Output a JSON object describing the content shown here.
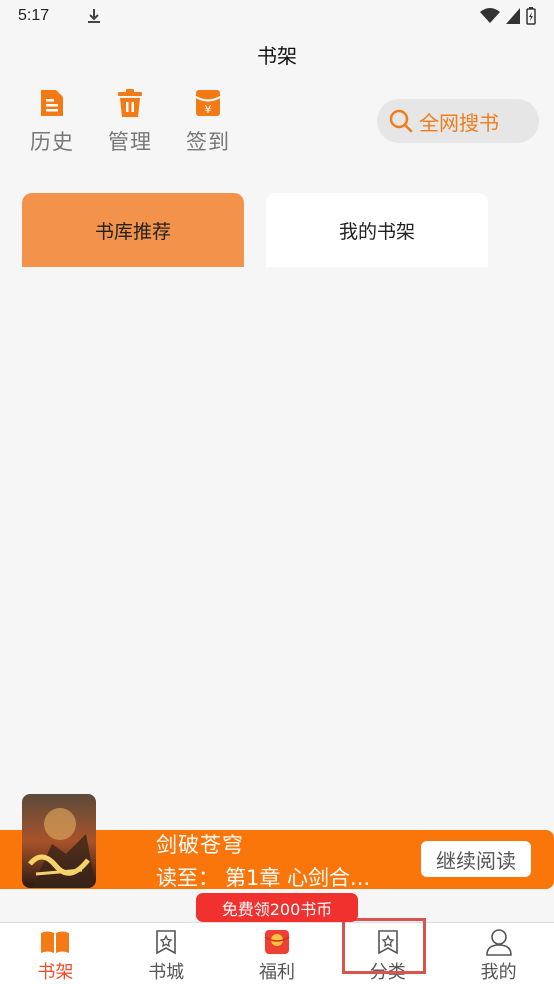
{
  "status_bar": {
    "time": "5:17"
  },
  "header": {
    "title": "书架"
  },
  "quick_actions": [
    {
      "label": "历史",
      "icon": "history-doc-icon"
    },
    {
      "label": "管理",
      "icon": "trash-icon"
    },
    {
      "label": "签到",
      "icon": "red-envelope-icon"
    }
  ],
  "search": {
    "label": "全网搜书",
    "icon": "search-icon"
  },
  "tabs": [
    {
      "label": "书库推荐",
      "active": true
    },
    {
      "label": "我的书架",
      "active": false
    }
  ],
  "continue_reading": {
    "book_title": "剑破苍穹",
    "progress_prefix": "读至：",
    "progress_chapter": "第1章 心剑合...",
    "button_label": "继续阅读"
  },
  "promo": {
    "label": "免费领200书币"
  },
  "bottom_nav": [
    {
      "label": "书架",
      "icon": "open-book-icon",
      "active": true
    },
    {
      "label": "书城",
      "icon": "star-bookmark-icon",
      "active": false
    },
    {
      "label": "福利",
      "icon": "gift-envelope-icon",
      "active": false
    },
    {
      "label": "分类",
      "icon": "star-bookmark-icon",
      "active": false
    },
    {
      "label": "我的",
      "icon": "user-icon",
      "active": false
    }
  ],
  "colors": {
    "accent": "#fb760a",
    "tab_active": "#f3924a",
    "nav_active": "#ef4e2a",
    "promo": "#f0312e",
    "background": "#f6f6f6"
  }
}
